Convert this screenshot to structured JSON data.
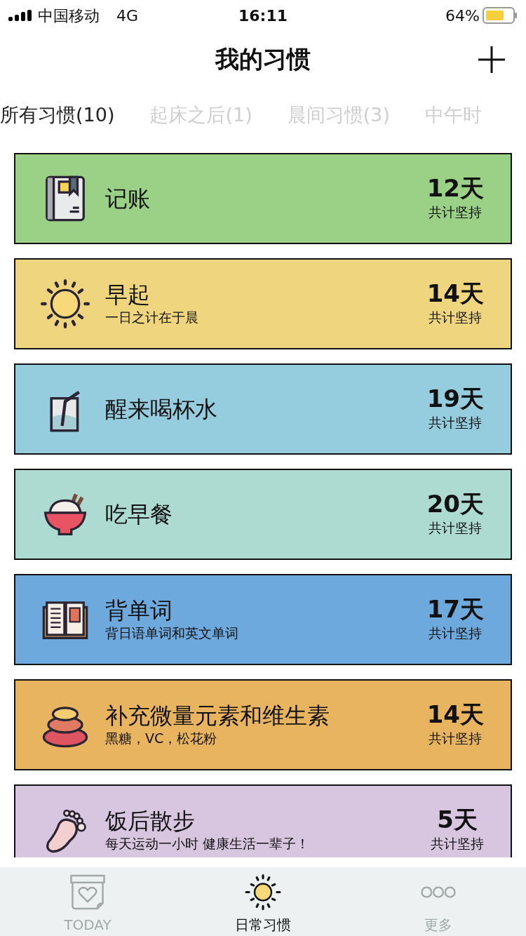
{
  "status_bar": {
    "carrier": "中国移动",
    "network": "4G",
    "time": "16:11",
    "battery": "64%"
  },
  "header": {
    "title": "我的习惯"
  },
  "tabs": [
    {
      "label": "所有习惯(10)",
      "selected": true
    },
    {
      "label": "起床之后(1)",
      "selected": false
    },
    {
      "label": "晨间习惯(3)",
      "selected": false
    },
    {
      "label": "中午时",
      "selected": false
    }
  ],
  "habits": [
    {
      "name": "记账",
      "days": "12天",
      "caption": "共计坚持",
      "color": "#9ad186"
    },
    {
      "name": "早起",
      "note": "一日之计在于晨",
      "days": "14天",
      "caption": "共计坚持",
      "color": "#efd67e"
    },
    {
      "name": "醒来喝杯水",
      "days": "19天",
      "caption": "共计坚持",
      "color": "#95cddf"
    },
    {
      "name": "吃早餐",
      "days": "20天",
      "caption": "共计坚持",
      "color": "#aedbd1"
    },
    {
      "name": "背单词",
      "note": "背日语单词和英文单词",
      "days": "17天",
      "caption": "共计坚持",
      "color": "#6da9dd"
    },
    {
      "name": "补充微量元素和维生素",
      "note": "黑糖，VC，松花粉",
      "days": "14天",
      "caption": "共计坚持",
      "color": "#e9b45f"
    },
    {
      "name": "饭后散步",
      "note": "每天运动一小时 健康生活一辈子！",
      "days": "5天",
      "caption": "共计坚持",
      "color": "#d8c5df"
    }
  ],
  "tab_bar": [
    {
      "label": "TODAY",
      "selected": false
    },
    {
      "label": "日常习惯",
      "selected": true
    },
    {
      "label": "更多",
      "selected": false
    }
  ]
}
